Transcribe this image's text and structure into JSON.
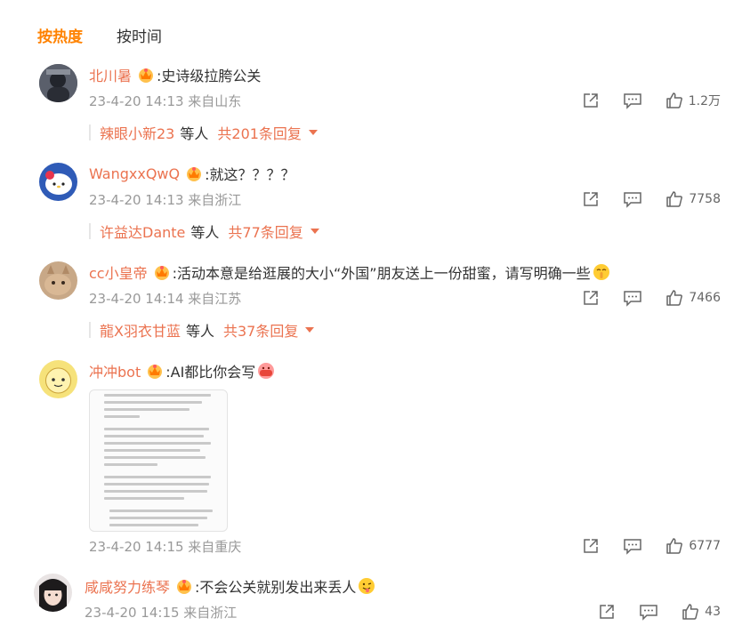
{
  "tabs": [
    {
      "label": "按热度",
      "active": true
    },
    {
      "label": "按时间",
      "active": false
    }
  ],
  "comments": [
    {
      "username": "北川暑",
      "content": ":史诗级拉胯公关",
      "time": "23-4-20 14:13 来自山东",
      "likes": "1.2万",
      "reply_user": "辣眼小新23",
      "reply_mid": "等人",
      "reply_total": "共201条回复"
    },
    {
      "username": "WangxxQwQ",
      "content": ":就这？？？？",
      "time": "23-4-20 14:13 来自浙江",
      "likes": "7758",
      "reply_user": "许益达Dante",
      "reply_mid": "等人",
      "reply_total": "共77条回复"
    },
    {
      "username": "cc小皇帝",
      "content": ":活动本意是给逛展的大小“外国”朋友送上一份甜蜜，请写明确一些",
      "time": "23-4-20 14:14 来自江苏",
      "likes": "7466",
      "reply_user": "龍X羽衣甘蓝",
      "reply_mid": "等人",
      "reply_total": "共37条回复"
    },
    {
      "username": "冲冲bot",
      "content": ":AI都比你会写",
      "time": "23-4-20 14:15 来自重庆",
      "likes": "6777"
    },
    {
      "username": "咸咸努力练琴",
      "content": ":不会公关就别发出来丢人",
      "time": "23-4-20 14:15 来自浙江",
      "likes": "43"
    }
  ],
  "icons": {
    "vip": "crown-badge-icon",
    "share": "share-icon",
    "comment": "comment-icon",
    "like": "thumbs-up-icon",
    "expand": "caret-down-icon"
  },
  "colors": {
    "accent": "#ff8200",
    "username": "#eb7350",
    "meta": "#999999"
  }
}
